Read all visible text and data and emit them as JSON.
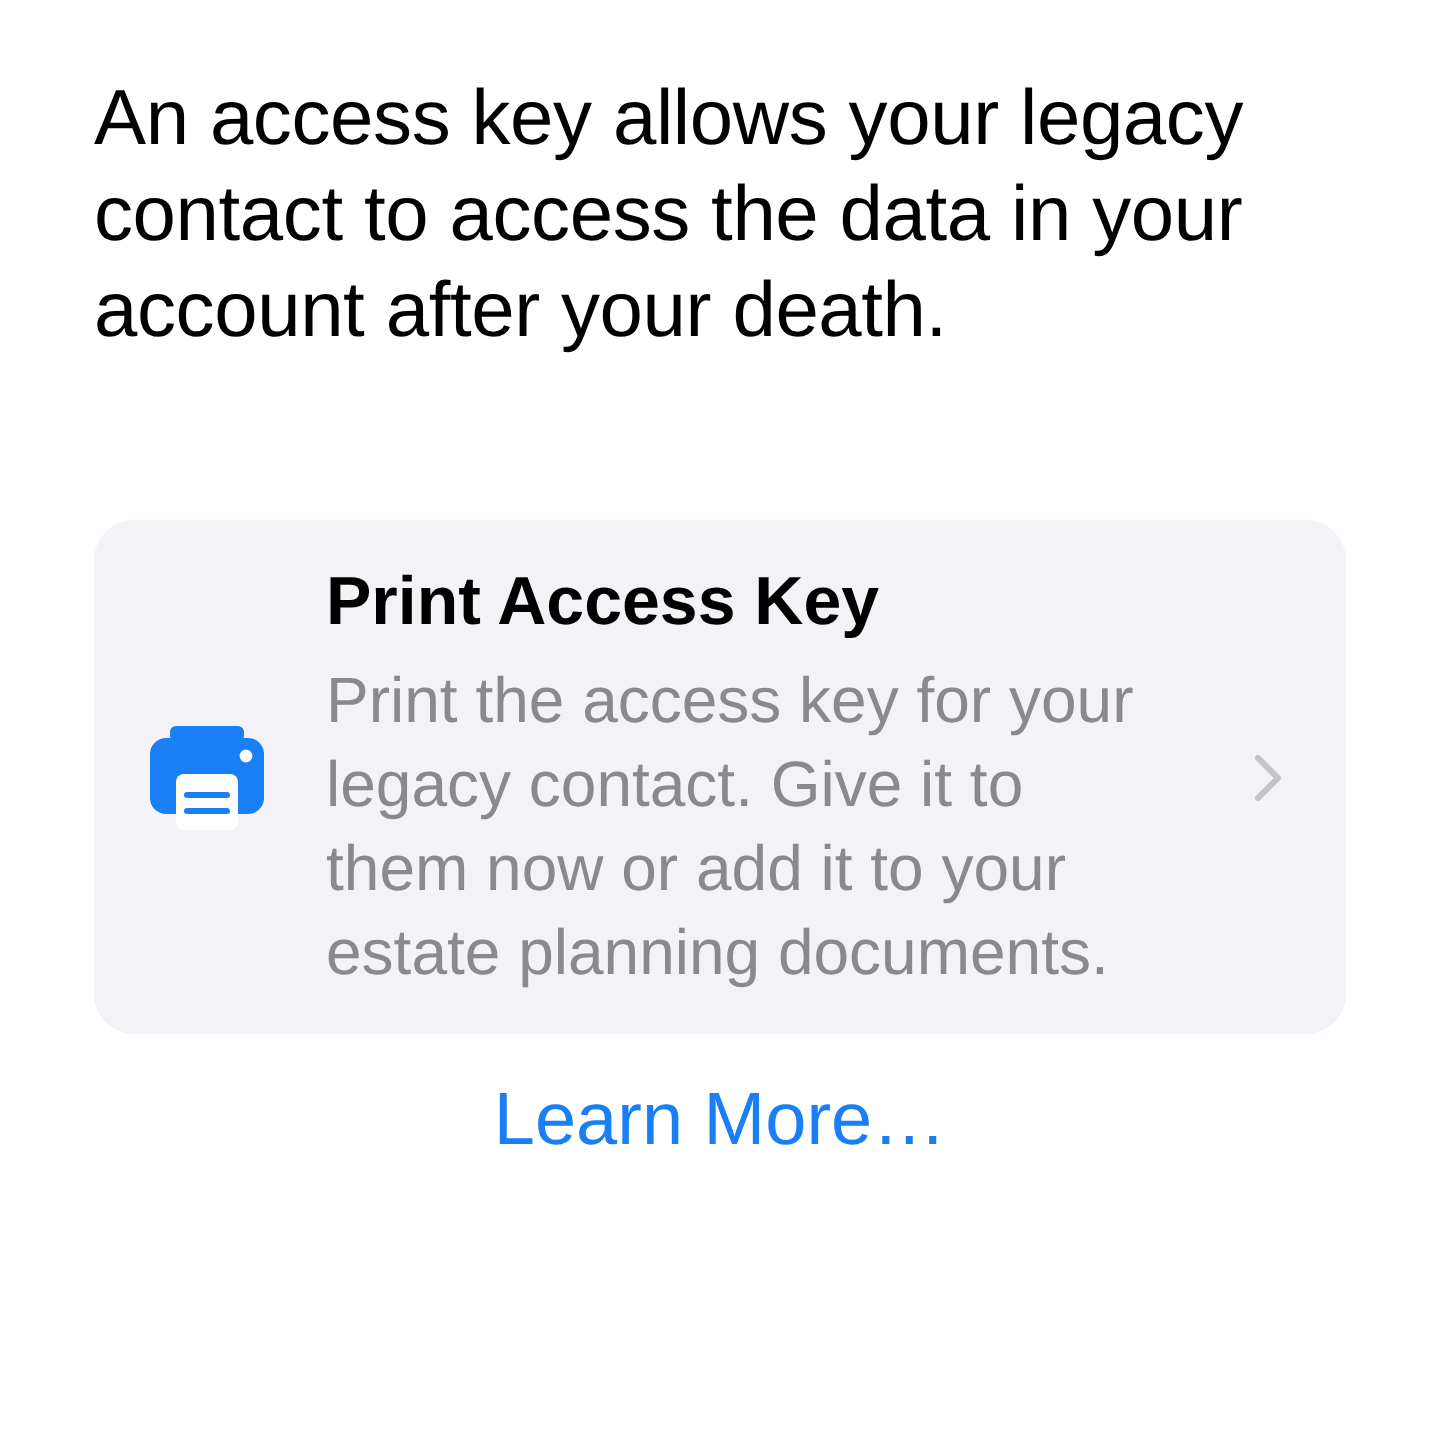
{
  "intro": "An access key allows your legacy contact to access the data in your account after your death.",
  "option_card": {
    "title": "Print Access Key",
    "description": "Print the access key for your legacy contact. Give it to them now or add it to your estate planning documents."
  },
  "link": "Learn More…"
}
